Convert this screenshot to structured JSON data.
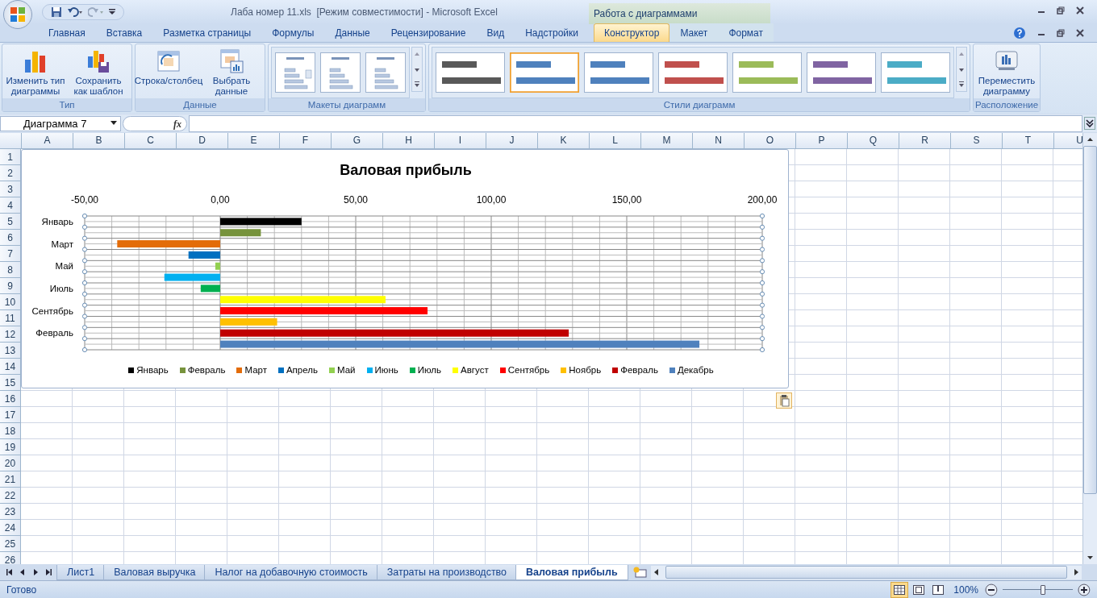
{
  "window": {
    "title": "Лаба номер 11.xls  [Режим совместимости] - Microsoft Excel"
  },
  "tabs": [
    {
      "label": "Главная",
      "selected": false
    },
    {
      "label": "Вставка",
      "selected": false
    },
    {
      "label": "Разметка страницы",
      "selected": false
    },
    {
      "label": "Формулы",
      "selected": false
    },
    {
      "label": "Данные",
      "selected": false
    },
    {
      "label": "Рецензирование",
      "selected": false
    },
    {
      "label": "Вид",
      "selected": false
    },
    {
      "label": "Надстройки",
      "selected": false
    }
  ],
  "chart_tools": {
    "label": "Работа с диаграммами",
    "tabs": [
      {
        "label": "Конструктор",
        "selected": true
      },
      {
        "label": "Макет",
        "selected": false
      },
      {
        "label": "Формат",
        "selected": false
      }
    ]
  },
  "ribbon": {
    "groups": [
      {
        "kind": "buttons",
        "label": "Тип",
        "buttons": [
          "Изменить тип диаграммы",
          "Сохранить как шаблон"
        ]
      },
      {
        "kind": "buttons",
        "label": "Данные",
        "buttons": [
          "Строка/столбец",
          "Выбрать данные"
        ]
      },
      {
        "kind": "layouts",
        "label": "Макеты диаграмм"
      },
      {
        "kind": "styles",
        "label": "Стили диаграмм",
        "styles": [
          {
            "color": "#595959",
            "selected": false
          },
          {
            "color": "#4f81bd",
            "selected": true
          },
          {
            "color": "#4f81bd",
            "selected": false
          },
          {
            "color": "#c0504d",
            "selected": false
          },
          {
            "color": "#9bbb59",
            "selected": false
          },
          {
            "color": "#8064a2",
            "selected": false
          },
          {
            "color": "#4bacc6",
            "selected": false
          }
        ]
      },
      {
        "kind": "buttons",
        "label": "Расположение",
        "buttons": [
          "Переместить диаграмму"
        ]
      }
    ]
  },
  "formula_bar": {
    "name_box": "Диаграмма 7",
    "function_label": "fx"
  },
  "columns": [
    "A",
    "B",
    "C",
    "D",
    "E",
    "F",
    "G",
    "H",
    "I",
    "J",
    "K",
    "L",
    "M",
    "N",
    "O",
    "P",
    "Q",
    "R",
    "S",
    "T",
    "U"
  ],
  "rows": [
    "1",
    "2",
    "3",
    "4",
    "5",
    "6",
    "7",
    "8",
    "9",
    "10",
    "11",
    "12",
    "13",
    "14",
    "15",
    "16",
    "17",
    "18",
    "19",
    "20",
    "21",
    "22",
    "23",
    "24",
    "25",
    "26"
  ],
  "chart": {
    "category_labels": [
      "Январь",
      "Март",
      "Май",
      "Июль",
      "Сентябрь",
      "Февраль"
    ],
    "chart_data": {
      "type": "bar",
      "orientation": "horizontal",
      "grid": true,
      "legend": true,
      "title": "Валовая прибыль",
      "xlim": [
        -50,
        200
      ],
      "xticks": [
        {
          "value": -50,
          "label": "-50,00"
        },
        {
          "value": 0,
          "label": "0,00"
        },
        {
          "value": 50,
          "label": "50,00"
        },
        {
          "value": 100,
          "label": "100,00"
        },
        {
          "value": 150,
          "label": "150,00"
        },
        {
          "value": 200,
          "label": "200,00"
        }
      ],
      "series": [
        {
          "name": "Январь",
          "color": "#000000",
          "values": [
            30
          ]
        },
        {
          "name": "Февраль",
          "color": "#77933c",
          "values": [
            15
          ]
        },
        {
          "name": "Март",
          "color": "#e36c09",
          "values": [
            -38
          ]
        },
        {
          "name": "Апрель",
          "color": "#0070c0",
          "values": [
            -11.7
          ]
        },
        {
          "name": "Май",
          "color": "#92d050",
          "values": [
            -1.8
          ]
        },
        {
          "name": "Июнь",
          "color": "#00b0f0",
          "values": [
            -20.6
          ]
        },
        {
          "name": "Июль",
          "color": "#00b050",
          "values": [
            -7.2
          ]
        },
        {
          "name": "Август",
          "color": "#ffff00",
          "values": [
            61
          ]
        },
        {
          "name": "Сентябрь",
          "color": "#ff0000",
          "values": [
            76.5
          ]
        },
        {
          "name": "Ноябрь",
          "color": "#ffc000",
          "values": [
            21
          ]
        },
        {
          "name": "Февраль",
          "color": "#c00000",
          "values": [
            128.6
          ]
        },
        {
          "name": "Декабрь",
          "color": "#4f81bd",
          "values": [
            176.8
          ]
        }
      ]
    }
  },
  "sheet_tabs": [
    {
      "label": "Лист1",
      "selected": false
    },
    {
      "label": "Валовая выручка",
      "selected": false
    },
    {
      "label": "Налог на добавочную стоимость",
      "selected": false
    },
    {
      "label": "Затраты на производство",
      "selected": false
    },
    {
      "label": "Валовая прибыль",
      "selected": true
    }
  ],
  "status_bar": {
    "text": "Готово",
    "views": [
      {
        "selected": true
      },
      {
        "selected": false
      },
      {
        "selected": false
      }
    ],
    "zoom": "100%",
    "zoom_slider": {
      "level": 0.57
    }
  }
}
